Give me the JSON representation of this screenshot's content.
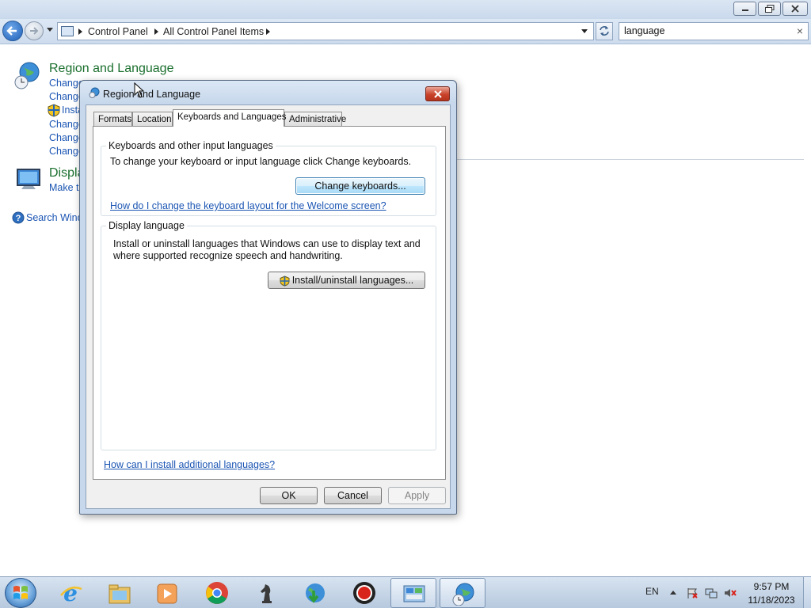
{
  "window": {
    "breadcrumb": [
      "Control Panel",
      "All Control Panel Items"
    ],
    "search": {
      "value": "language"
    }
  },
  "results": [
    {
      "title": "Region and Language",
      "links": [
        "Change",
        "Change",
        "Insta",
        "Change",
        "Change",
        "Change"
      ]
    },
    {
      "title": "Displa",
      "links": [
        "Make te"
      ]
    }
  ],
  "search_windows_help": "Search Wind",
  "dialog": {
    "title": "Region and Language",
    "tabs": [
      "Formats",
      "Location",
      "Keyboards and Languages",
      "Administrative"
    ],
    "active_tab": "Keyboards and Languages",
    "keyboards_group": {
      "label": "Keyboards and other input languages",
      "description": "To change your keyboard or input language click Change keyboards.",
      "button": "Change keyboards...",
      "link": "How do I change the keyboard layout for the Welcome screen?"
    },
    "display_group": {
      "label": "Display language",
      "description": "Install or uninstall languages that Windows can use to display text and where supported recognize speech and handwriting.",
      "button": "Install/uninstall languages..."
    },
    "bottom_link": "How can I install additional languages?",
    "buttons": {
      "ok": "OK",
      "cancel": "Cancel",
      "apply": "Apply"
    }
  },
  "taskbar": {
    "pinned": [
      "internet-explorer",
      "windows-explorer",
      "media-player",
      "chrome",
      "chess",
      "download-manager",
      "screen-recorder",
      "control-panel",
      "region-and-language"
    ],
    "language": "EN",
    "time": "9:57 PM",
    "date": "11/18/2023"
  }
}
